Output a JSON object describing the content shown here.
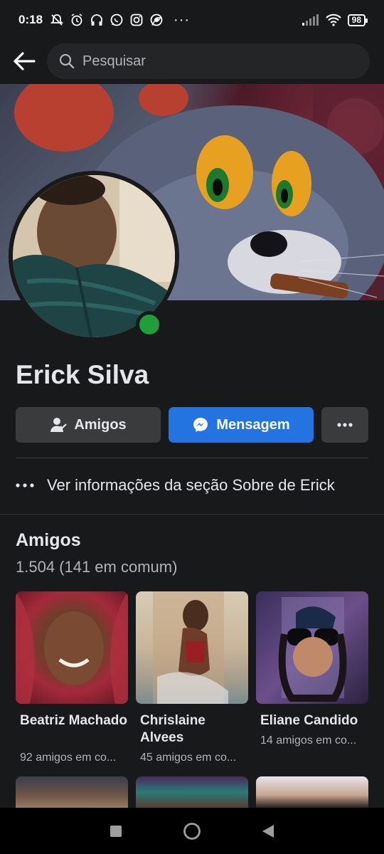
{
  "status_bar": {
    "time": "0:18",
    "battery": "98",
    "more": "···"
  },
  "search": {
    "placeholder": "Pesquisar"
  },
  "profile": {
    "name": "Erick Silva",
    "online": true
  },
  "actions": {
    "friends_label": "Amigos",
    "message_label": "Mensagem"
  },
  "about": {
    "label": "Ver informações da seção Sobre de Erick"
  },
  "friends": {
    "title": "Amigos",
    "count": "1.504 (141 em comum)",
    "items": [
      {
        "name": "Beatriz Machado",
        "mutual": "92 amigos em co..."
      },
      {
        "name": "Chrislaine Alvees",
        "mutual": "45 amigos em co..."
      },
      {
        "name": "Eliane Candido",
        "mutual": "14 amigos em co..."
      }
    ]
  },
  "colors": {
    "background": "#18191a",
    "button": "#3a3b3c",
    "accent": "#2374e1",
    "online": "#1f9e3b"
  }
}
